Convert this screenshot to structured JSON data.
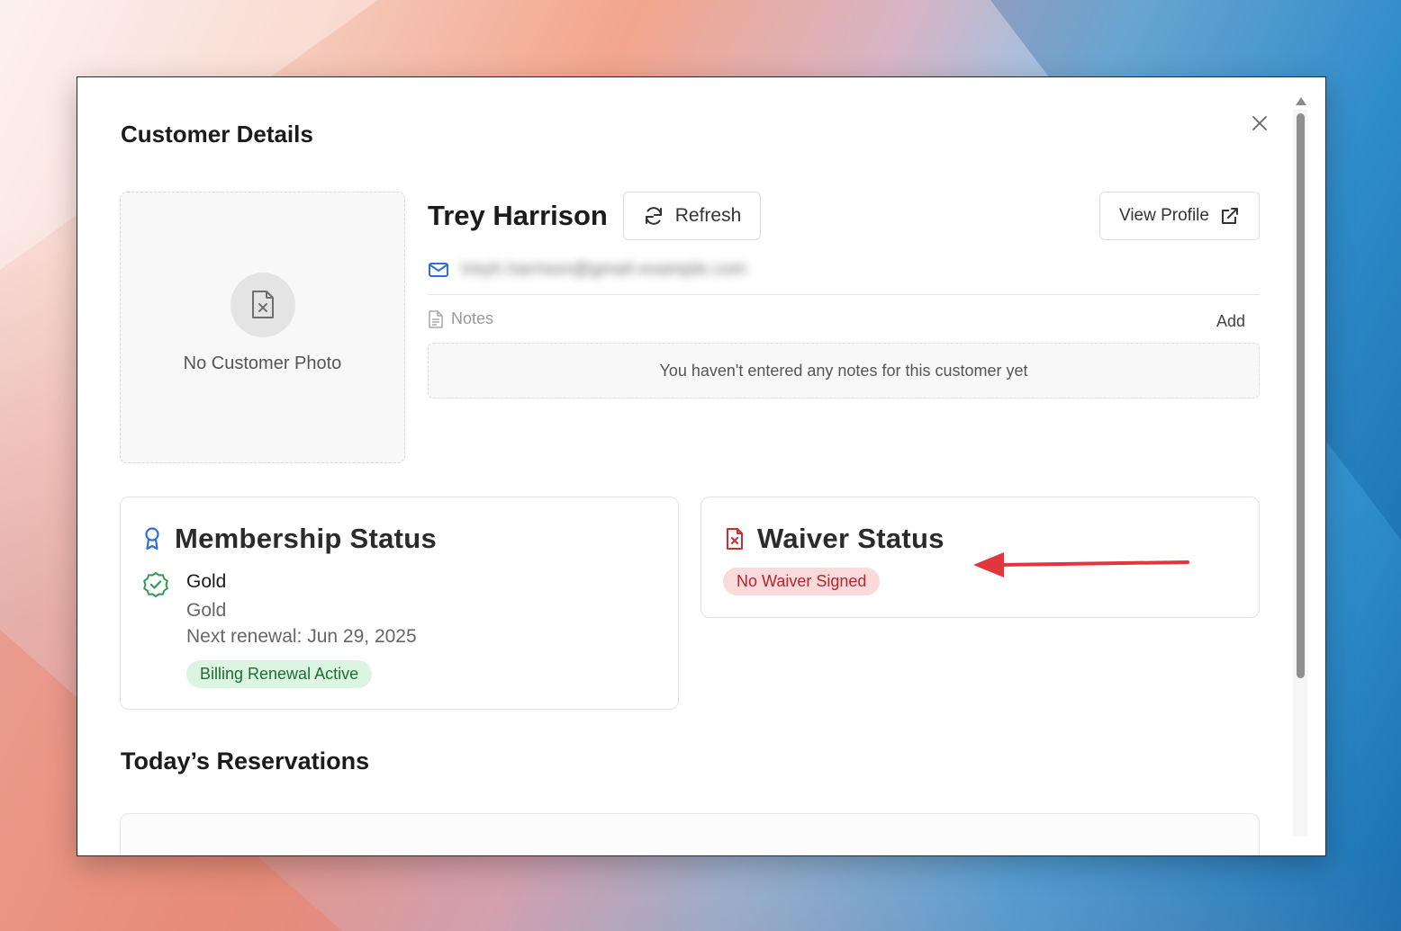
{
  "modal": {
    "title": "Customer Details",
    "close_icon": "close-icon"
  },
  "photo": {
    "icon": "file-x-icon",
    "label": "No Customer Photo"
  },
  "customer": {
    "name": "Trey Harrison",
    "email": "treyh.harrison@gmail-example.com",
    "email_icon": "mail-icon"
  },
  "actions": {
    "refresh_label": "Refresh",
    "view_profile_label": "View Profile"
  },
  "notes": {
    "label": "Notes",
    "add_label": "Add",
    "empty_text": "You haven't entered any notes for this customer yet"
  },
  "membership": {
    "title": "Membership Status",
    "tier_name": "Gold",
    "tier_subtitle": "Gold",
    "renewal": "Next renewal: Jun 29, 2025",
    "badge": "Billing Renewal Active",
    "colors": {
      "icon": "#2f6fd6",
      "check": "#2f9a52",
      "badge_bg": "#dcf5e3",
      "badge_text": "#1e6b35"
    }
  },
  "waiver": {
    "title": "Waiver Status",
    "badge": "No Waiver Signed",
    "colors": {
      "icon": "#c53030",
      "badge_bg": "#fadada",
      "badge_text": "#b3262e"
    }
  },
  "annotation": {
    "arrow_color": "#e0373e"
  },
  "reservations": {
    "title": "Today’s Reservations"
  }
}
